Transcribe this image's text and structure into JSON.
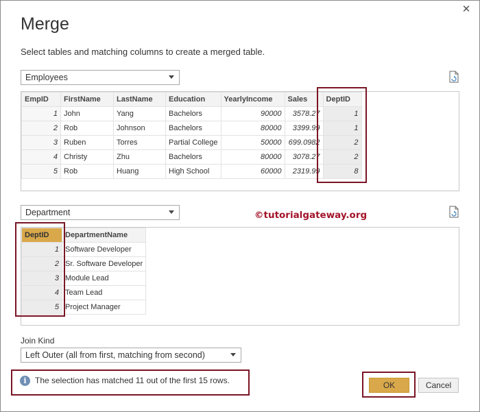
{
  "dialog": {
    "title": "Merge",
    "subtitle": "Select tables and matching columns to create a merged table.",
    "close_symbol": "✕"
  },
  "first_table": {
    "selected": "Employees",
    "columns": [
      "EmpID",
      "FirstName",
      "LastName",
      "Education",
      "YearlyIncome",
      "Sales",
      "DeptID"
    ],
    "rows": [
      [
        "1",
        "John",
        "Yang",
        "Bachelors",
        "90000",
        "3578.27",
        "1"
      ],
      [
        "2",
        "Rob",
        "Johnson",
        "Bachelors",
        "80000",
        "3399.99",
        "1"
      ],
      [
        "3",
        "Ruben",
        "Torres",
        "Partial College",
        "50000",
        "699.0982",
        "2"
      ],
      [
        "4",
        "Christy",
        "Zhu",
        "Bachelors",
        "80000",
        "3078.27",
        "2"
      ],
      [
        "5",
        "Rob",
        "Huang",
        "High School",
        "60000",
        "2319.99",
        "8"
      ]
    ]
  },
  "second_table": {
    "selected": "Department",
    "columns": [
      "DeptID",
      "DepartmentName"
    ],
    "rows": [
      [
        "1",
        "Software Developer"
      ],
      [
        "2",
        "Sr. Software Developer"
      ],
      [
        "3",
        "Module Lead"
      ],
      [
        "4",
        "Team Lead"
      ],
      [
        "5",
        "Project Manager"
      ]
    ]
  },
  "watermark": "©tutorialgateway.org",
  "join_kind": {
    "label": "Join Kind",
    "selected": "Left Outer (all from first, matching from second)"
  },
  "status": {
    "message": "The selection has matched 11 out of the first 15 rows."
  },
  "buttons": {
    "ok": "OK",
    "cancel": "Cancel"
  },
  "colors": {
    "selected_column": "#d9a84a",
    "highlight_box": "#7a1424",
    "watermark": "#a3142a"
  }
}
